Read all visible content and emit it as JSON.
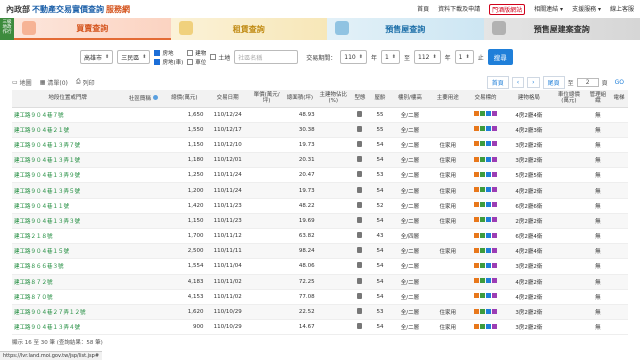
{
  "brand": {
    "moi": "內政部",
    "title1": "不動產交易實價查詢",
    "title2": "服務網"
  },
  "topnav": [
    "首頁",
    "資料下載及申請",
    "門酒版網站",
    "相關連結 ▾",
    "支援服務 ▾",
    "線上客服"
  ],
  "side_tag": "三級 地政 作行",
  "tabs": [
    "買賣查詢",
    "租賃查詢",
    "預售屋查詢",
    "預售屋建案查詢"
  ],
  "filters": {
    "city": "高雄市",
    "district": "三民區",
    "checks": [
      {
        "label": "房地",
        "on": true
      },
      {
        "label": "建物",
        "on": false
      },
      {
        "label": "土地",
        "on": false
      },
      {
        "label": "房地(車)",
        "on": true
      },
      {
        "label": "車位",
        "on": false
      }
    ],
    "community_placeholder": "社區名稱",
    "period_label": "交易期間：",
    "from_year": "110",
    "from_unit": "年",
    "from_month": "1",
    "mid": "至",
    "to_year": "112",
    "to_unit": "年",
    "to_month": "1",
    "end_unit": "止",
    "search": "搜尋"
  },
  "toolbar": {
    "map": "地圖",
    "list": "清單(0)",
    "print": "列印",
    "first": "首頁",
    "prev": "‹",
    "next": "›",
    "last": "尾頁",
    "to": "至",
    "page": "2",
    "pages": "頁",
    "go": "GO"
  },
  "headers": [
    "地段位置或門牌",
    "社區簡稱",
    "總價(萬元)",
    "交易日期",
    "單價(萬元/坪)",
    "總面積(坪)",
    "主建物佔比(%)",
    "型態",
    "屋齡",
    "樓別/樓高",
    "主要用途",
    "交易標的",
    "建物格局",
    "車位總價(萬元)",
    "管理組織",
    "電梯"
  ],
  "rows": [
    [
      "建工路９０４巷７號",
      "",
      "1,650",
      "110/12/24",
      "",
      "48.93",
      "",
      "",
      "55",
      "全/二層",
      "",
      "",
      "4房2廳4衛",
      "",
      "無",
      ""
    ],
    [
      "建工路９０４巷２１號",
      "",
      "1,550",
      "110/12/17",
      "",
      "30.38",
      "",
      "",
      "55",
      "全/二層",
      "",
      "",
      "4房2廳3衛",
      "",
      "無",
      ""
    ],
    [
      "建工路９０４巷１３弄７號",
      "",
      "1,150",
      "110/12/10",
      "",
      "19.73",
      "",
      "",
      "54",
      "全/二層",
      "住家用",
      "",
      "3房2廳2衛",
      "",
      "無",
      ""
    ],
    [
      "建工路９０４巷１３弄１號",
      "",
      "1,180",
      "110/12/01",
      "",
      "20.31",
      "",
      "",
      "54",
      "全/二層",
      "住家用",
      "",
      "3房2廳2衛",
      "",
      "無",
      ""
    ],
    [
      "建工路９０４巷１３弄９號",
      "",
      "1,250",
      "110/11/24",
      "",
      "20.47",
      "",
      "",
      "53",
      "全/二層",
      "住家用",
      "",
      "5房2廳5衛",
      "",
      "無",
      ""
    ],
    [
      "建工路９０４巷１３弄５號",
      "",
      "1,200",
      "110/11/24",
      "",
      "19.73",
      "",
      "",
      "54",
      "全/二層",
      "住家用",
      "",
      "4房2廳2衛",
      "",
      "無",
      ""
    ],
    [
      "建工路９０４巷１１號",
      "",
      "1,420",
      "110/11/23",
      "",
      "48.22",
      "",
      "",
      "52",
      "全/二層",
      "住家用",
      "",
      "6房2廳6衛",
      "",
      "無",
      ""
    ],
    [
      "建工路９０４巷１３弄３號",
      "",
      "1,150",
      "110/11/23",
      "",
      "19.69",
      "",
      "",
      "54",
      "全/二層",
      "住家用",
      "",
      "2房2廳2衛",
      "",
      "無",
      ""
    ],
    [
      "建工路２１８號",
      "",
      "1,700",
      "110/11/12",
      "",
      "63.82",
      "",
      "",
      "43",
      "全/四層",
      "",
      "",
      "6房2廳4衛",
      "",
      "無",
      ""
    ],
    [
      "建工路９０４巷１５號",
      "",
      "2,500",
      "110/11/11",
      "",
      "98.24",
      "",
      "",
      "54",
      "全/二層",
      "住家用",
      "",
      "4房2廳4衛",
      "",
      "無",
      ""
    ],
    [
      "建工路８６６巷３號",
      "",
      "1,554",
      "110/11/04",
      "",
      "48.06",
      "",
      "",
      "54",
      "全/二層",
      "",
      "",
      "3房2廳2衛",
      "",
      "無",
      ""
    ],
    [
      "建工路８７２號",
      "",
      "4,183",
      "110/11/02",
      "",
      "72.25",
      "",
      "",
      "54",
      "全/二層",
      "",
      "",
      "4房2廳2衛",
      "",
      "無",
      ""
    ],
    [
      "建工路８７０號",
      "",
      "4,153",
      "110/11/02",
      "",
      "77.08",
      "",
      "",
      "54",
      "全/二層",
      "",
      "",
      "4房2廳2衛",
      "",
      "無",
      ""
    ],
    [
      "建工路９０４巷２７弄１２號",
      "",
      "1,620",
      "110/10/29",
      "",
      "22.52",
      "",
      "",
      "53",
      "全/二層",
      "住家用",
      "",
      "3房2廳2衛",
      "",
      "無",
      ""
    ],
    [
      "建工路９０４巷１３弄４號",
      "",
      "900",
      "110/10/29",
      "",
      "14.67",
      "",
      "",
      "54",
      "全/二層",
      "住家用",
      "",
      "3房2廳2衛",
      "",
      "無",
      ""
    ]
  ],
  "footer": "顯示 16 至 30 筆 (查詢結果：58 筆)",
  "status_url": "https://lvr.land.moi.gov.tw/jsp/list.jsp#"
}
